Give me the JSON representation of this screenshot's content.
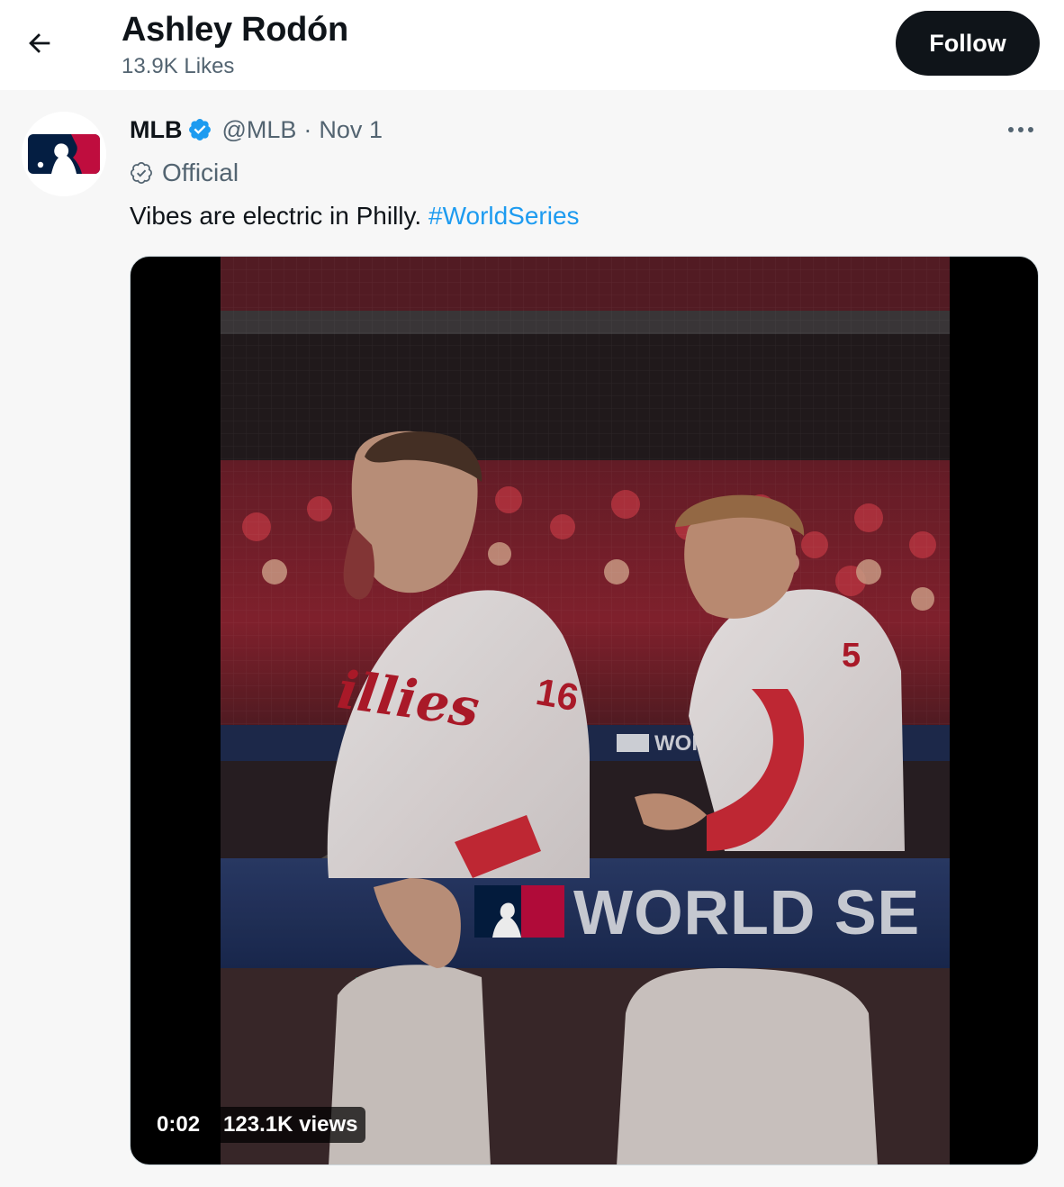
{
  "header": {
    "back_icon": "arrow-left-icon",
    "profile_name": "Ashley Rodón",
    "likes_count": "13.9K Likes",
    "follow_label": "Follow"
  },
  "tweet": {
    "author_name": "MLB",
    "verified_icon": "verified-badge-icon",
    "handle": "@MLB",
    "separator": "·",
    "date": "Nov 1",
    "more_icon": "more-options-icon",
    "official_label": "Official",
    "text": "Vibes are electric in Philly.",
    "hashtag": "#WorldSeries",
    "media": {
      "type": "video",
      "banner_text": "WORLD SE",
      "banner_text_small": "WOR",
      "jersey_script": "illies",
      "jersey_number_left": "16",
      "jersey_number_right": "5",
      "timestamp": "0:02",
      "views": "123.1K views"
    }
  },
  "colors": {
    "follow_bg": "#0f1419",
    "link": "#1d9bf0",
    "secondary_text": "#536471",
    "verified": "#1d9bf0",
    "mlb_blue": "#041e42",
    "mlb_red": "#bf0d3e"
  }
}
